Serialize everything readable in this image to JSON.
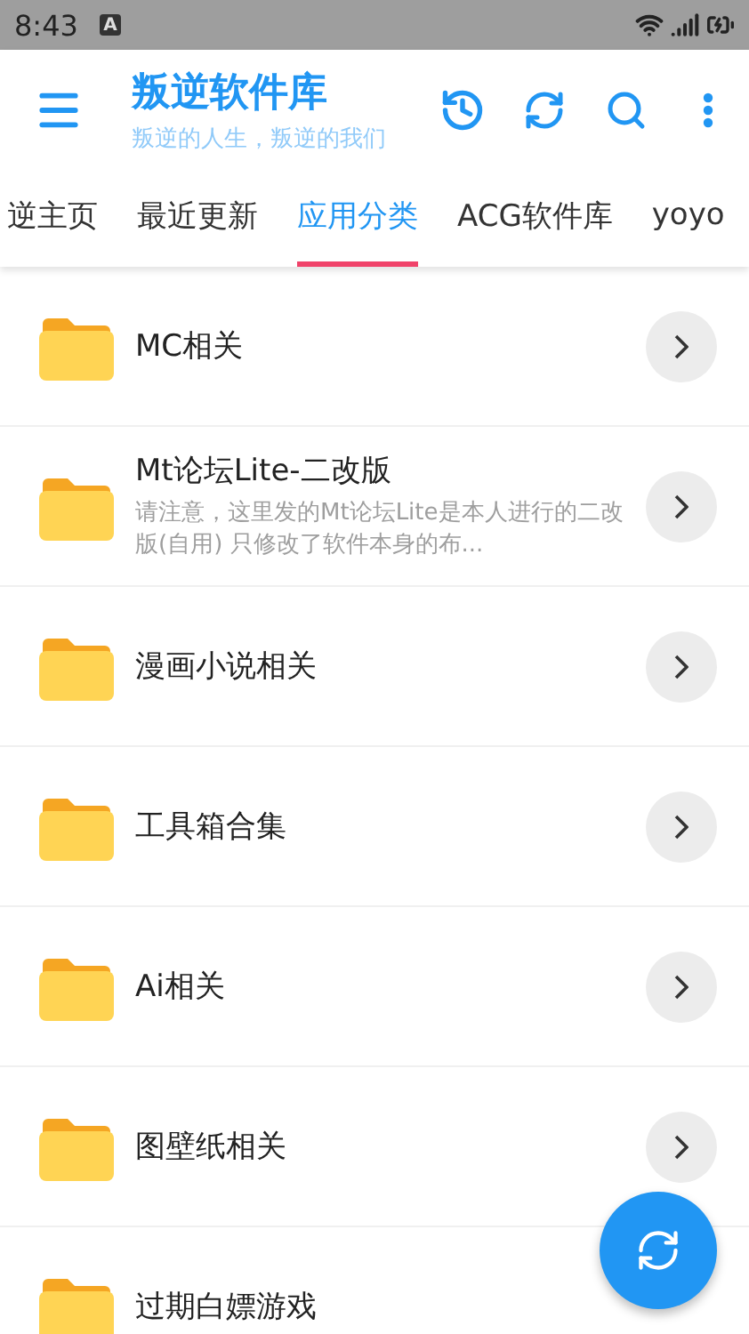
{
  "status_bar": {
    "time": "8:43",
    "notification": "A"
  },
  "app_bar": {
    "title": "叛逆软件库",
    "subtitle": "叛逆的人生，叛逆的我们"
  },
  "tabs": [
    {
      "label": "逆主页",
      "selected": false
    },
    {
      "label": "最近更新",
      "selected": false
    },
    {
      "label": "应用分类",
      "selected": true
    },
    {
      "label": "ACG软件库",
      "selected": false
    },
    {
      "label": "yoyo",
      "selected": false
    }
  ],
  "categories": [
    {
      "title": "MC相关"
    },
    {
      "title": "Mt论坛Lite-二改版",
      "description": "请注意，这里发的Mt论坛Lite是本人进行的二改版(自用) 只修改了软件本身的布..."
    },
    {
      "title": "漫画小说相关"
    },
    {
      "title": "工具箱合集"
    },
    {
      "title": "Ai相关"
    },
    {
      "title": "图壁纸相关"
    },
    {
      "title": "过期白嫖游戏"
    }
  ]
}
